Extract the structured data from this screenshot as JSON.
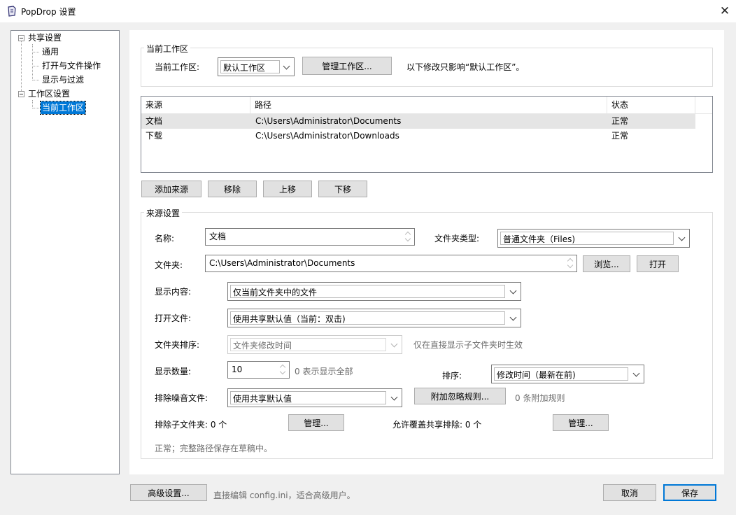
{
  "window": {
    "title": "PopDrop 设置",
    "accent": "#0078d7"
  },
  "tree": {
    "groups": [
      {
        "label": "共享设置",
        "children": [
          "通用",
          "打开与文件操作",
          "显示与过滤"
        ]
      },
      {
        "label": "工作区设置",
        "children": [
          "当前工作区"
        ]
      }
    ],
    "selected": "当前工作区"
  },
  "workspace": {
    "group_label": "当前工作区",
    "label": "当前工作区:",
    "value": "默认工作区",
    "manage_button": "管理工作区...",
    "hint": "以下修改只影响“默认工作区”。"
  },
  "sources_table": {
    "columns": [
      "来源",
      "路径",
      "状态"
    ],
    "rows": [
      {
        "source": "文档",
        "path": "C:\\Users\\Administrator\\Documents",
        "status": "正常"
      },
      {
        "source": "下载",
        "path": "C:\\Users\\Administrator\\Downloads",
        "status": "正常"
      }
    ]
  },
  "table_buttons": {
    "add": "添加来源",
    "remove": "移除",
    "up": "上移",
    "down": "下移"
  },
  "source_settings": {
    "group_label": "来源设置",
    "name_label": "名称:",
    "name_value": "文档",
    "folder_type_label": "文件夹类型:",
    "folder_type_value": "普通文件夹（Files)",
    "folder_label": "文件夹:",
    "folder_value": "C:\\Users\\Administrator\\Documents",
    "browse_button": "浏览...",
    "open_button": "打开",
    "display_content_label": "显示内容:",
    "display_content_value": "仅当前文件夹中的文件",
    "open_file_label": "打开文件:",
    "open_file_value": "使用共享默认值（当前：双击)",
    "folder_sort_label": "文件夹排序:",
    "folder_sort_value": "文件夹修改时间",
    "folder_sort_hint": "仅在直接显示子文件夹时生效",
    "count_label": "显示数量:",
    "count_value": "10",
    "count_hint": "0 表示显示全部",
    "sort_label": "排序:",
    "sort_value": "修改时间（最新在前)",
    "noise_label": "排除噪音文件:",
    "noise_value": "使用共享默认值",
    "ignore_rules_button": "附加忽略规则...",
    "ignore_rules_hint": "0 条附加规则",
    "exclude_subfolders_label": "排除子文件夹: 0 个",
    "exclude_manage_button": "管理...",
    "allow_override_label": "允许覆盖共享排除: 0 个",
    "override_manage_button": "管理...",
    "status_text": "正常；完整路径保存在草稿中。"
  },
  "footer": {
    "advanced_button": "高级设置...",
    "advanced_hint": "直接编辑 config.ini，适合高级用户。",
    "cancel_button": "取消",
    "save_button": "保存"
  }
}
